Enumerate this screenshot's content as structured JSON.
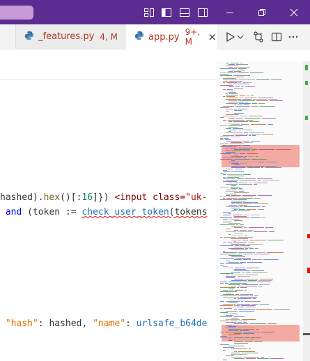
{
  "tabs": [
    {
      "name": "_features.py",
      "badge": "4, M",
      "active": false
    },
    {
      "name": "app.py",
      "badge": "9+, M",
      "active": true
    }
  ],
  "tab_close_glyph": "×",
  "icons": {
    "python": "python-icon",
    "run": "play-icon",
    "run_menu": "chevron-down-icon",
    "compare": "git-compare-icon",
    "split": "split-editor-icon",
    "more": "more-actions-icon",
    "layout": [
      "customize-layout-icon",
      "toggle-sidebar-icon",
      "toggle-panel-icon",
      "toggle-secondary-sidebar-icon"
    ],
    "window": [
      "minimize-icon",
      "restore-icon",
      "close-icon"
    ]
  },
  "code": {
    "line1": {
      "t1": "hashed",
      "t2": ").",
      "t3": "hex",
      "t4": "()[:",
      "t5": "16",
      "t6": "]}) ",
      "t7": "<input class=",
      "t8": "\"uk-"
    },
    "line2": {
      "t1": " and ",
      "t2": "(token := ",
      "t3": "check_user_token",
      "t4": "(tokens"
    },
    "line3": {
      "t1": "\"hash\"",
      "t2": ": hashed, ",
      "t3": "\"name\"",
      "t4": ": ",
      "t5": "urlsafe_b64de"
    }
  },
  "colors": {
    "titlebar": "#5c2d91",
    "modified_tab_text": "#b0351f",
    "error_marker": "#e51400",
    "added_marker": "#48a948"
  }
}
